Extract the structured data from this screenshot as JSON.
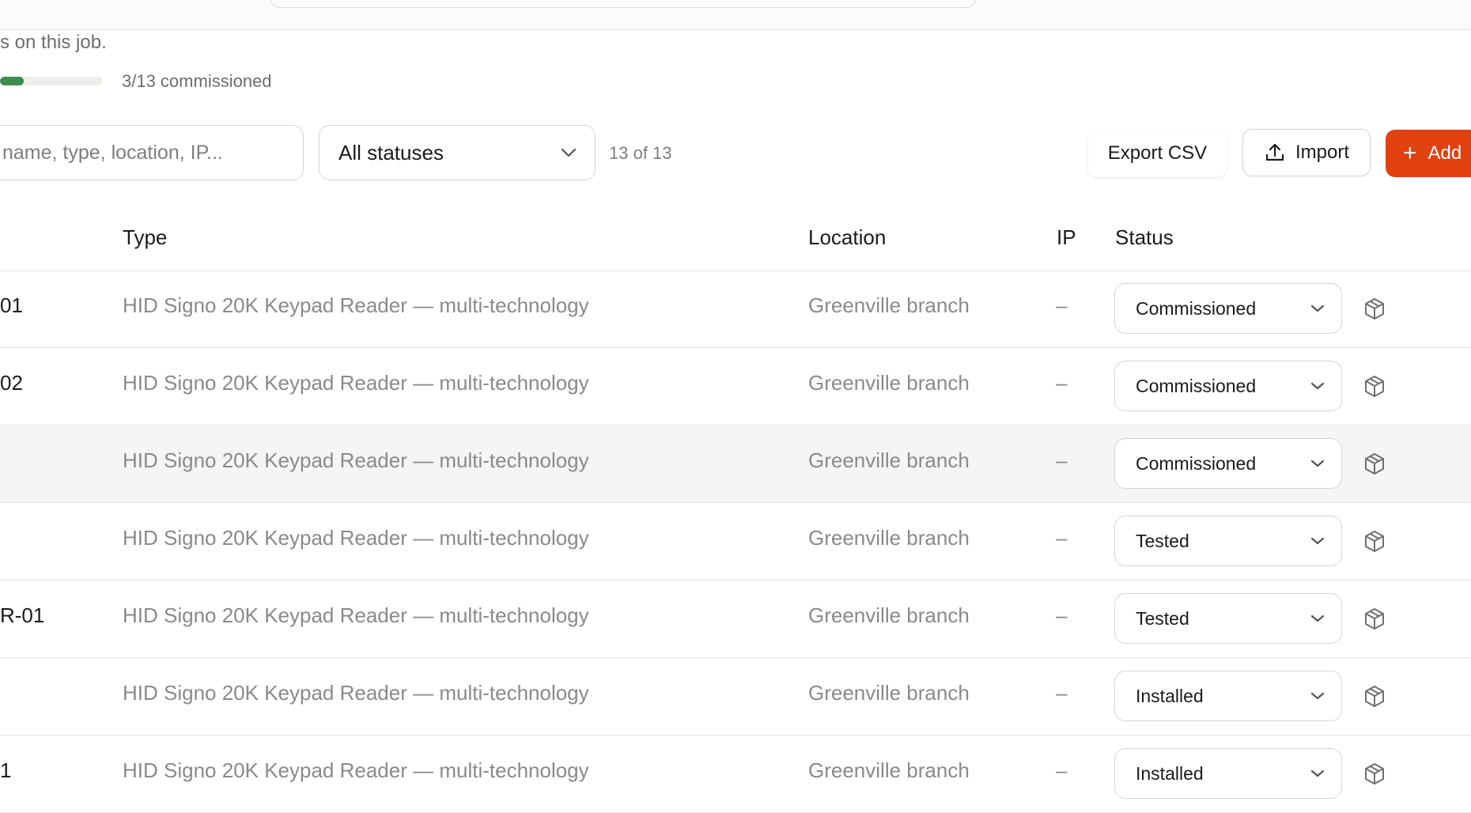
{
  "job": {
    "description": "s on this job.",
    "progress": {
      "done": 3,
      "total": 13,
      "fraction": 0.23,
      "label": "3/13 commissioned"
    }
  },
  "toolbar": {
    "search_placeholder": "name, type, location, IP...",
    "status_filter": "All statuses",
    "count_label": "13 of 13",
    "export_label": "Export CSV",
    "import_label": "Import",
    "add_label": "Add"
  },
  "table": {
    "columns": {
      "type": "Type",
      "location": "Location",
      "ip": "IP",
      "status": "Status"
    },
    "rows": [
      {
        "name": "01",
        "type": "HID Signo 20K Keypad Reader — multi-technology",
        "location": "Greenville branch",
        "ip": "–",
        "status": "Commissioned"
      },
      {
        "name": "02",
        "type": "HID Signo 20K Keypad Reader — multi-technology",
        "location": "Greenville branch",
        "ip": "–",
        "status": "Commissioned"
      },
      {
        "name": "",
        "type": "HID Signo 20K Keypad Reader — multi-technology",
        "location": "Greenville branch",
        "ip": "–",
        "status": "Commissioned"
      },
      {
        "name": "",
        "type": "HID Signo 20K Keypad Reader — multi-technology",
        "location": "Greenville branch",
        "ip": "–",
        "status": "Tested"
      },
      {
        "name": "R-01",
        "type": "HID Signo 20K Keypad Reader — multi-technology",
        "location": "Greenville branch",
        "ip": "–",
        "status": "Tested"
      },
      {
        "name": "",
        "type": "HID Signo 20K Keypad Reader — multi-technology",
        "location": "Greenville branch",
        "ip": "–",
        "status": "Installed"
      },
      {
        "name": "1",
        "type": "HID Signo 20K Keypad Reader — multi-technology",
        "location": "Greenville branch",
        "ip": "–",
        "status": "Installed"
      }
    ]
  },
  "colors": {
    "accent": "#e0410e",
    "progress_fill": "#3d8c4f",
    "hover_row": "#f6f5f3",
    "muted_text": "#8a8a87"
  },
  "icons": {
    "row_action": "cube-icon",
    "import": "upload-icon",
    "filter": "chevron-down-icon",
    "add": "plus-icon"
  }
}
